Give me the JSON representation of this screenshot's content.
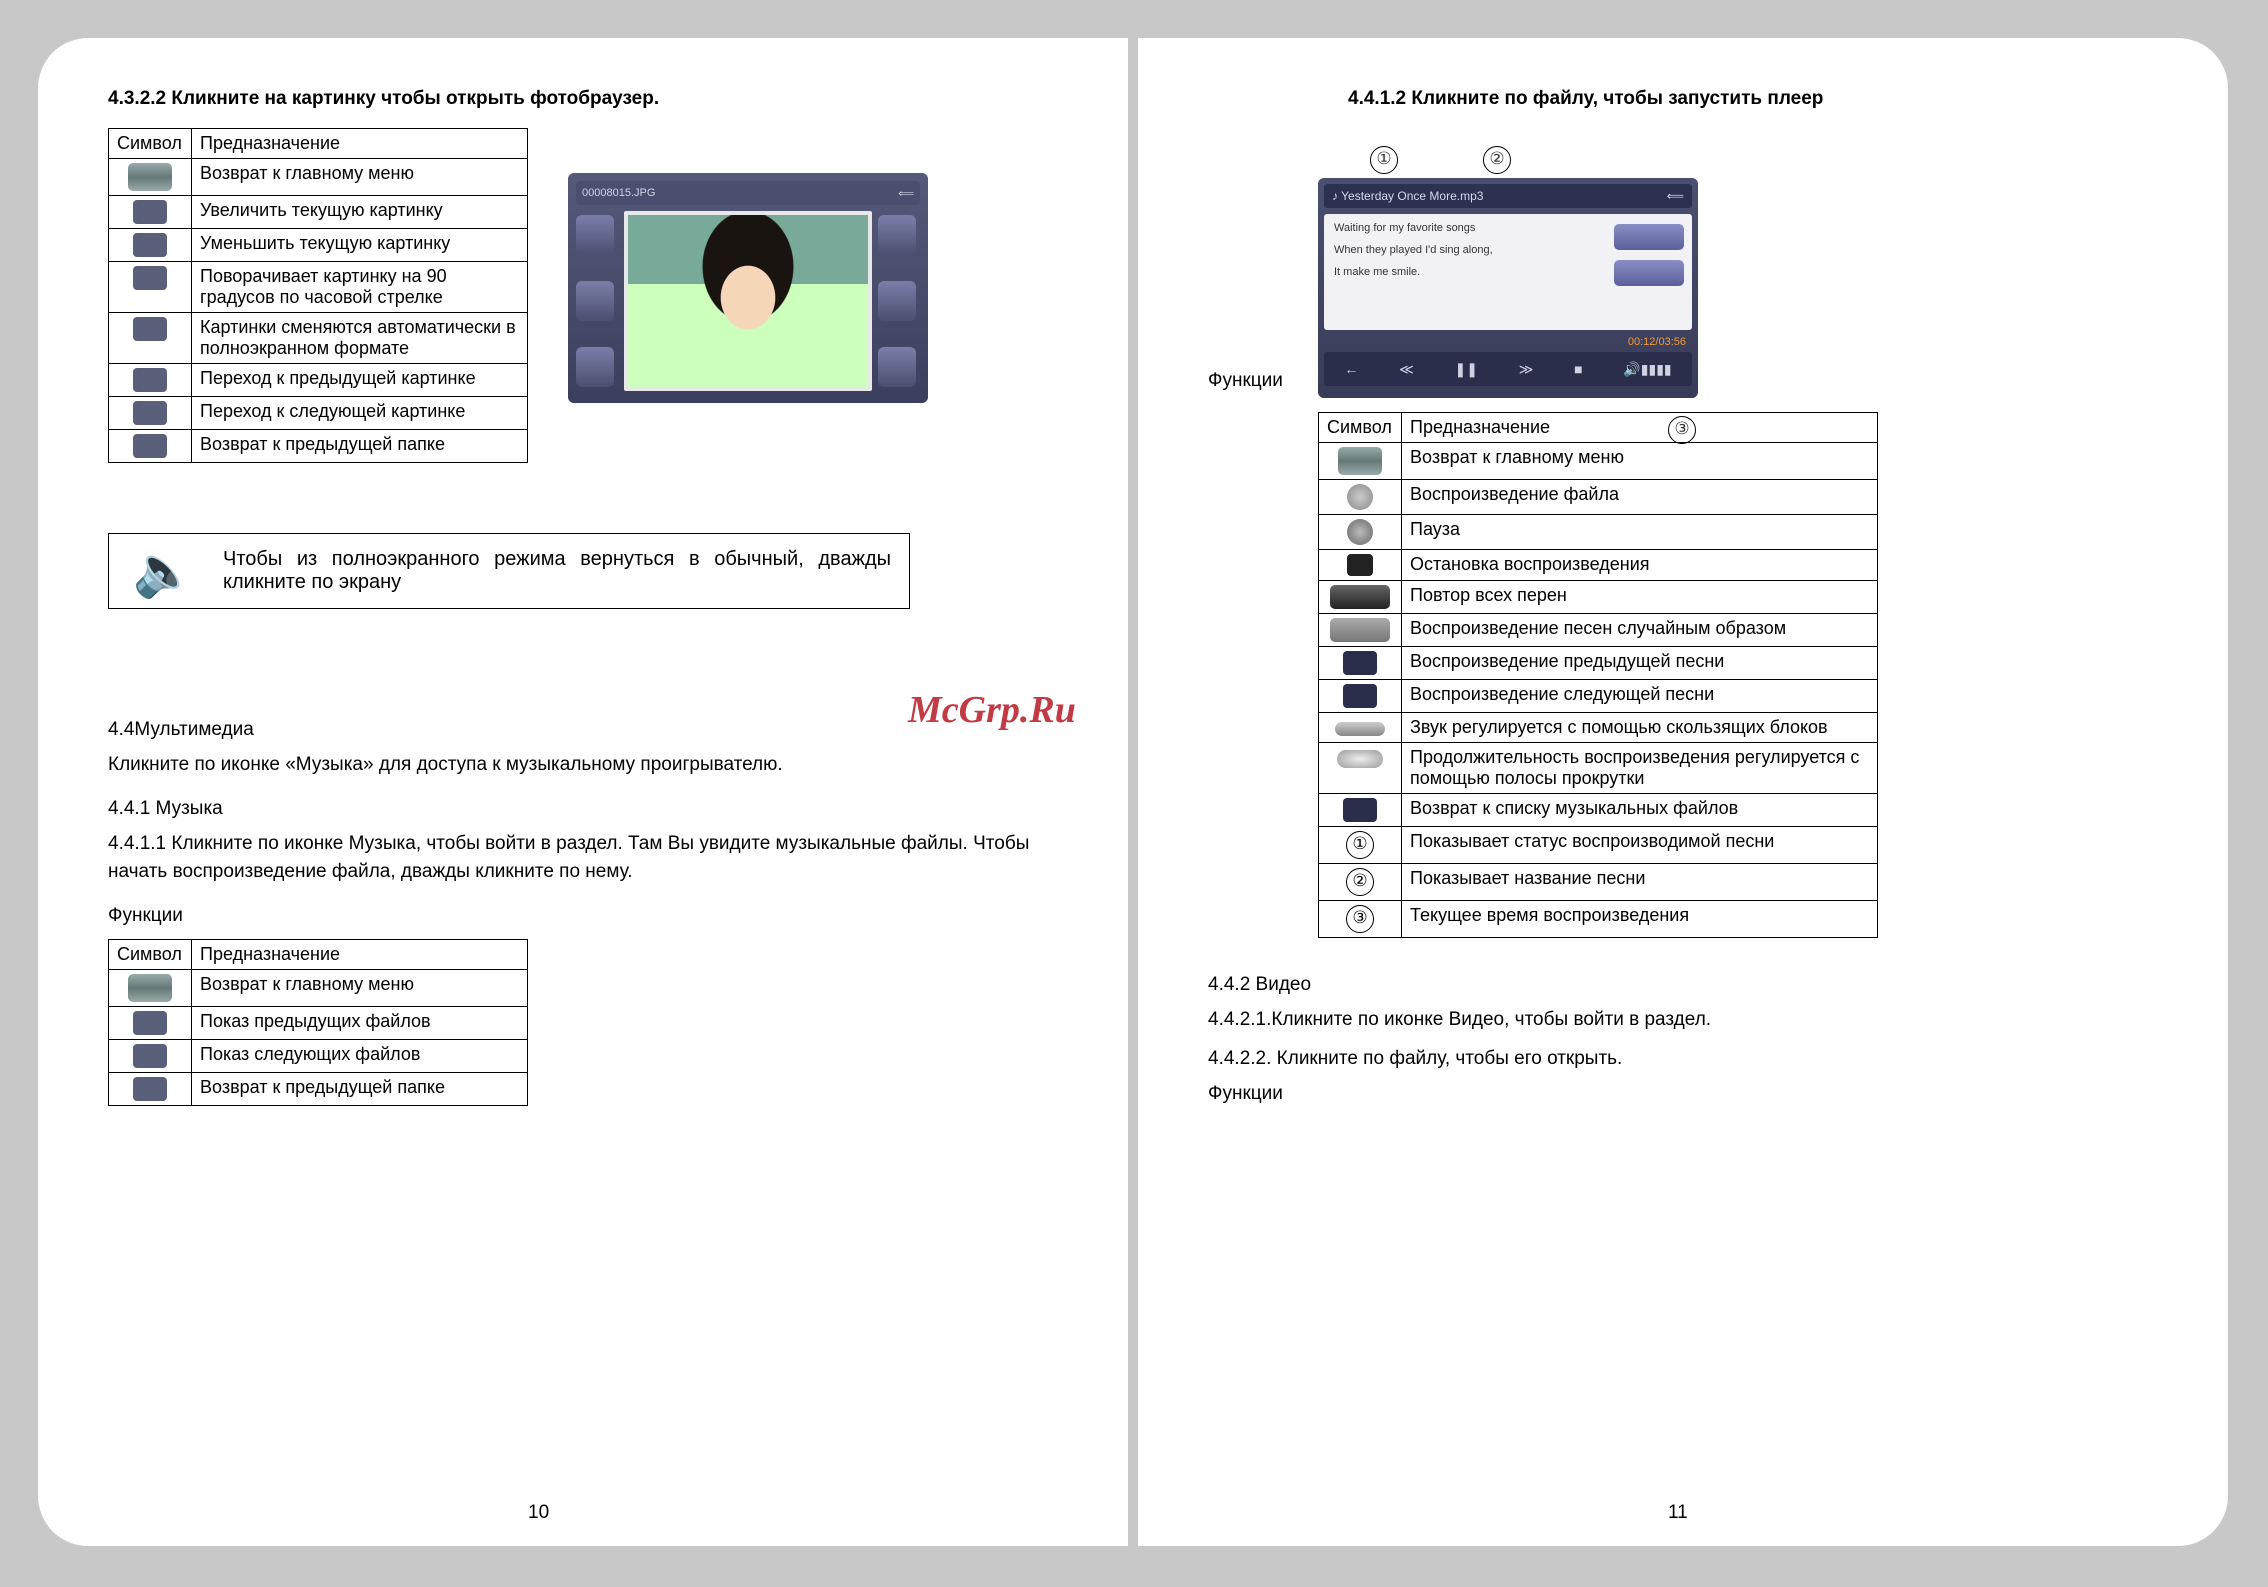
{
  "watermark": "McGrp.Ru",
  "left": {
    "h1": "4.3.2.2 Кликните на картинку чтобы открыть фотобраузер.",
    "table1": {
      "head": [
        "Символ",
        "Предназначение"
      ],
      "rows": [
        "Возврат к главному меню",
        "Увеличить текущую картинку",
        "Уменьшить текущую картинку",
        "Поворачивает картинку на 90 градусов по часовой стрелке",
        "Картинки сменяются автоматически в полноэкранном формате",
        "Переход к предыдущей картинке",
        "Переход к следующей картинке",
        "Возврат к предыдущей папке"
      ]
    },
    "note": "Чтобы из полноэкранного режима вернуться в обычный, дважды кликните по экрану",
    "s44": "4.4Мультимедиа",
    "s44_body": "Кликните по иконке «Музыка» для доступа к музыкальному проигрывателю.",
    "s441": "4.4.1 Музыка",
    "s4411": "4.4.1.1 Кликните по иконке Музыка, чтобы войти в раздел. Там Вы увидите музыкальные файлы. Чтобы начать воспроизведение файла, дважды кликните по нему.",
    "func": "Функции",
    "table2": {
      "head": [
        "Символ",
        "Предназначение"
      ],
      "rows": [
        "Возврат к главному меню",
        "Показ предыдущих файлов",
        "Показ следующих файлов",
        "Возврат к предыдущей папке"
      ]
    },
    "page": "10",
    "photo_caption": "00008015.JPG"
  },
  "right": {
    "h1": "4.4.1.2 Кликните по файлу, чтобы запустить плеер",
    "func": "Функции",
    "music": {
      "title": "Yesterday Once More.mp3",
      "lyric1": "Waiting for my favorite songs",
      "lyric2": "When they played I'd sing along,",
      "lyric3": "It make me smile.",
      "time": "00:12/03:56"
    },
    "callouts": {
      "c1": "①",
      "c2": "②",
      "c3": "③"
    },
    "table": {
      "head": [
        "Символ",
        "Предназначение"
      ],
      "rows": [
        {
          "icon": "bar",
          "text": "Возврат к главному меню"
        },
        {
          "icon": "play",
          "text": "Воспроизведение файла"
        },
        {
          "icon": "pause",
          "text": "Пауза"
        },
        {
          "icon": "stop",
          "text": "Остановка воспроизведения"
        },
        {
          "icon": "repeat",
          "text": "Повтор всех перен"
        },
        {
          "icon": "shuffle",
          "text": "Воспроизведение песен случайным образом"
        },
        {
          "icon": "prev",
          "text": "Воспроизведение предыдущей песни"
        },
        {
          "icon": "next",
          "text": "Воспроизведение следующей песни"
        },
        {
          "icon": "slider",
          "text": "Звук регулируется с помощью скользящих блоков"
        },
        {
          "icon": "progress",
          "text": "Продолжительность воспроизведения регулируется с помощью полосы прокрутки"
        },
        {
          "icon": "back",
          "text": "Возврат к списку музыкальных файлов"
        },
        {
          "icon": "c1",
          "text": "Показывает статус воспроизводимой песни"
        },
        {
          "icon": "c2",
          "text": "Показывает название песни"
        },
        {
          "icon": "c3",
          "text": "Текущее время воспроизведения"
        }
      ]
    },
    "s442": "4.4.2 Видео",
    "s4421": "4.4.2.1.Кликните по иконке Видео, чтобы войти в раздел.",
    "s4422": "4.4.2.2. Кликните по файлу, чтобы его открыть.",
    "func2": "Функции",
    "page": "11"
  }
}
